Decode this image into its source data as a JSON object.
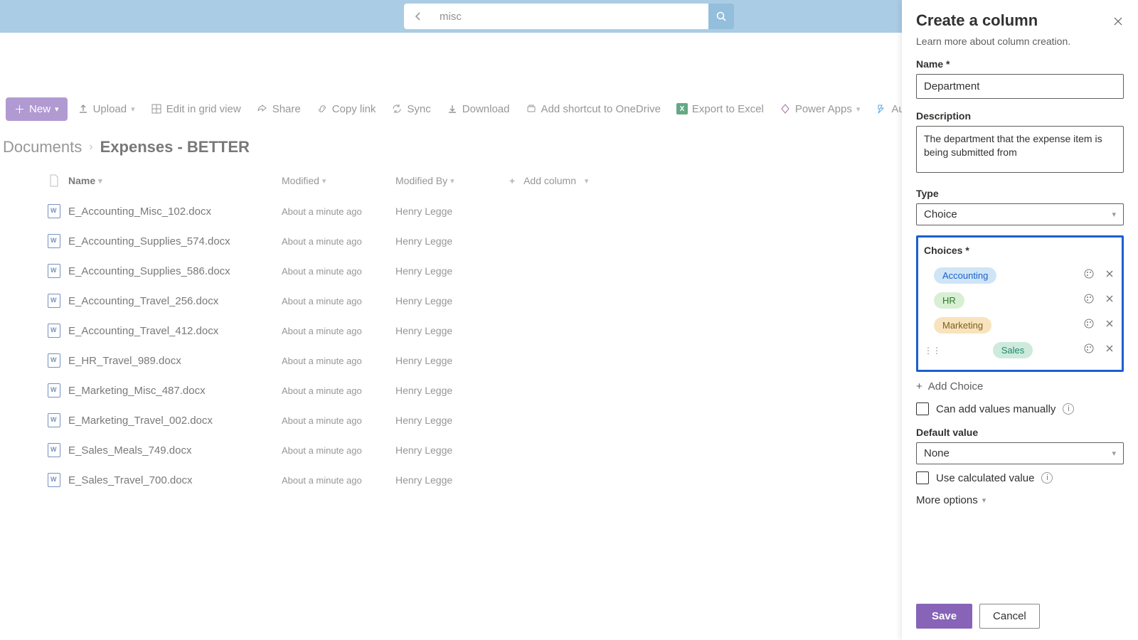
{
  "search": {
    "value": "misc"
  },
  "commands": {
    "new": "New",
    "upload": "Upload",
    "edit_grid": "Edit in grid view",
    "share": "Share",
    "copy_link": "Copy link",
    "sync": "Sync",
    "download": "Download",
    "shortcut": "Add shortcut to OneDrive",
    "export_excel": "Export to Excel",
    "power_apps": "Power Apps",
    "automate": "Automate"
  },
  "breadcrumb": {
    "root": "Documents",
    "current": "Expenses - BETTER"
  },
  "table": {
    "headers": {
      "name": "Name",
      "modified": "Modified",
      "modified_by": "Modified By",
      "add_column": "Add column"
    },
    "rows": [
      {
        "name": "E_Accounting_Misc_102.docx",
        "modified": "About a minute ago",
        "modified_by": "Henry Legge"
      },
      {
        "name": "E_Accounting_Supplies_574.docx",
        "modified": "About a minute ago",
        "modified_by": "Henry Legge"
      },
      {
        "name": "E_Accounting_Supplies_586.docx",
        "modified": "About a minute ago",
        "modified_by": "Henry Legge"
      },
      {
        "name": "E_Accounting_Travel_256.docx",
        "modified": "About a minute ago",
        "modified_by": "Henry Legge"
      },
      {
        "name": "E_Accounting_Travel_412.docx",
        "modified": "About a minute ago",
        "modified_by": "Henry Legge"
      },
      {
        "name": "E_HR_Travel_989.docx",
        "modified": "About a minute ago",
        "modified_by": "Henry Legge"
      },
      {
        "name": "E_Marketing_Misc_487.docx",
        "modified": "About a minute ago",
        "modified_by": "Henry Legge"
      },
      {
        "name": "E_Marketing_Travel_002.docx",
        "modified": "About a minute ago",
        "modified_by": "Henry Legge"
      },
      {
        "name": "E_Sales_Meals_749.docx",
        "modified": "About a minute ago",
        "modified_by": "Henry Legge"
      },
      {
        "name": "E_Sales_Travel_700.docx",
        "modified": "About a minute ago",
        "modified_by": "Henry Legge"
      }
    ]
  },
  "panel": {
    "title": "Create a column",
    "subtitle": "Learn more about column creation.",
    "name_label": "Name *",
    "name_value": "Department",
    "desc_label": "Description",
    "desc_value": "The department that the expense item is being submitted from",
    "type_label": "Type",
    "type_value": "Choice",
    "choices_label": "Choices *",
    "choices": [
      {
        "label": "Accounting",
        "bg": "#cfe5f6",
        "fg": "#1a5fd0"
      },
      {
        "label": "HR",
        "bg": "#d9efd3",
        "fg": "#2d7a2d"
      },
      {
        "label": "Marketing",
        "bg": "#f7e3bd",
        "fg": "#7a5f1a"
      },
      {
        "label": "Sales",
        "bg": "#cdeadd",
        "fg": "#1f8a6a"
      }
    ],
    "add_choice": "Add Choice",
    "manual_label": "Can add values manually",
    "default_label": "Default value",
    "default_value": "None",
    "calc_label": "Use calculated value",
    "more_options": "More options",
    "save": "Save",
    "cancel": "Cancel"
  }
}
